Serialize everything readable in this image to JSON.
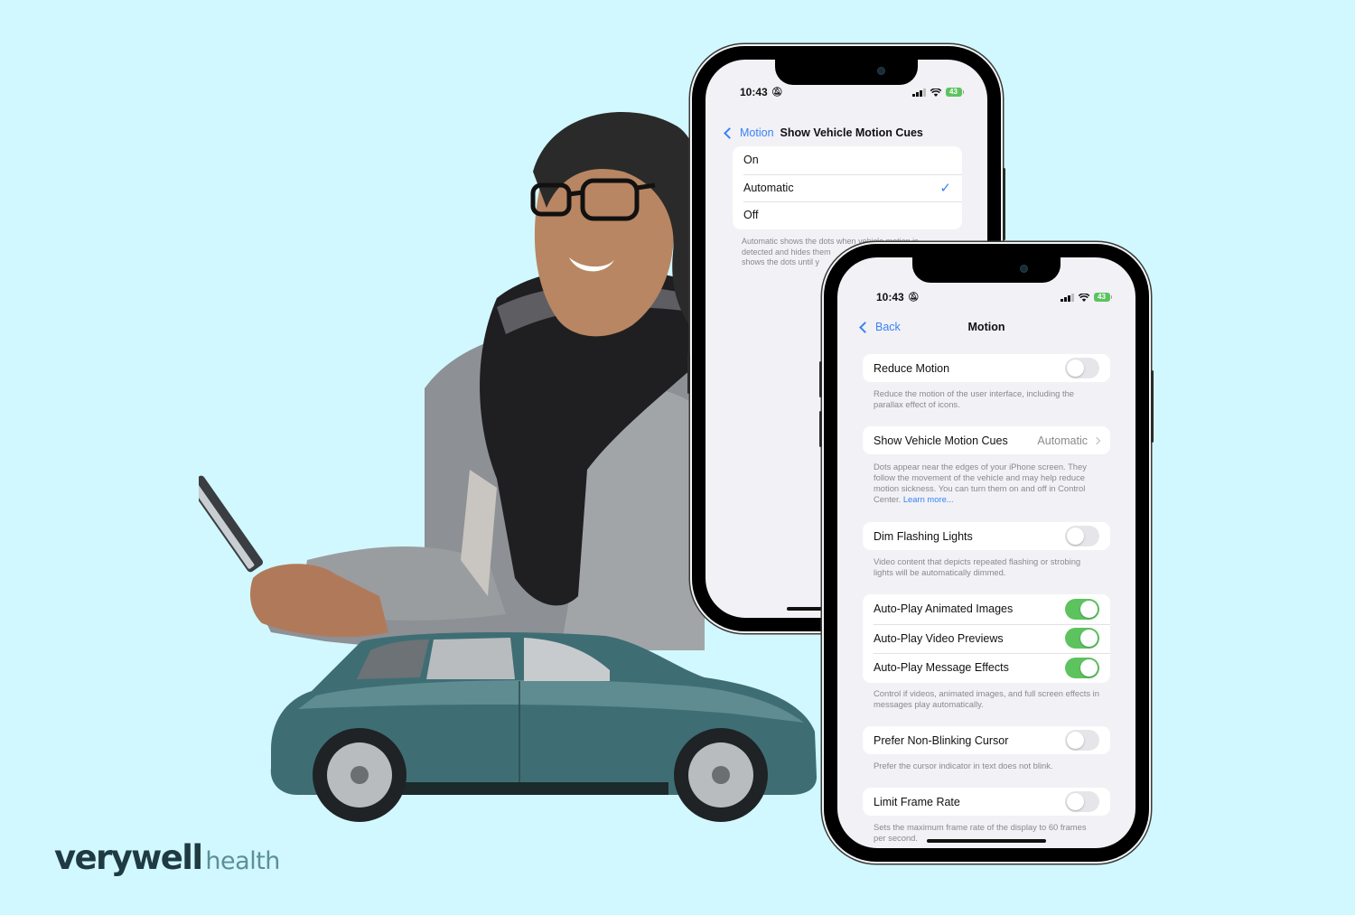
{
  "brand": {
    "primary": "verywell",
    "secondary": "health",
    "primary_color": "#1f3a43",
    "secondary_color": "#5d8f98"
  },
  "background_color": "#d1f8fe",
  "illustrations": {
    "person": "woman-with-glasses-scarf-looking-at-phone",
    "vehicle": "teal-suv-car"
  },
  "status_bar": {
    "time": "10:43",
    "silent_icon": "bell-slash-icon",
    "battery": "43"
  },
  "back_phone": {
    "nav": {
      "back_label": "Motion",
      "title": "Show Vehicle Motion Cues"
    },
    "options": [
      {
        "label": "On",
        "selected": false
      },
      {
        "label": "Automatic",
        "selected": true
      },
      {
        "label": "Off",
        "selected": false
      }
    ],
    "check_glyph": "✓",
    "footnote_lines": [
      "Automatic shows the dots when vehicle motion is",
      "detected and hides them",
      "shows the dots until y"
    ]
  },
  "front_phone": {
    "nav": {
      "back_label": "Back",
      "title": "Motion"
    },
    "sections": [
      {
        "rows": [
          {
            "label": "Reduce Motion",
            "type": "toggle",
            "on": false
          }
        ],
        "footnote": "Reduce the motion of the user interface, including the parallax effect of icons."
      },
      {
        "rows": [
          {
            "label": "Show Vehicle Motion Cues",
            "type": "value",
            "value": "Automatic"
          }
        ],
        "footnote": "Dots appear near the edges of your iPhone screen. They follow the movement of the vehicle and may help reduce motion sickness. You can turn them on and off in Control Center.",
        "footnote_link": "Learn more..."
      },
      {
        "rows": [
          {
            "label": "Dim Flashing Lights",
            "type": "toggle",
            "on": false
          }
        ],
        "footnote": "Video content that depicts repeated flashing or strobing lights will be automatically dimmed."
      },
      {
        "rows": [
          {
            "label": "Auto-Play Animated Images",
            "type": "toggle",
            "on": true
          },
          {
            "label": "Auto-Play Video Previews",
            "type": "toggle",
            "on": true
          },
          {
            "label": "Auto-Play Message Effects",
            "type": "toggle",
            "on": true
          }
        ],
        "footnote": "Control if videos, animated images, and full screen effects in messages play automatically."
      },
      {
        "rows": [
          {
            "label": "Prefer Non-Blinking Cursor",
            "type": "toggle",
            "on": false
          }
        ],
        "footnote": "Prefer the cursor indicator in text does not blink."
      },
      {
        "rows": [
          {
            "label": "Limit Frame Rate",
            "type": "toggle",
            "on": false
          }
        ],
        "footnote": "Sets the maximum frame rate of the display to 60 frames per second."
      }
    ]
  },
  "colors": {
    "accent_blue": "#3a82f6",
    "toggle_on": "#5cc35f",
    "toggle_off": "#e6e6ea",
    "screen_bg": "#f1f1f6",
    "footnote": "#8a8a8e"
  }
}
